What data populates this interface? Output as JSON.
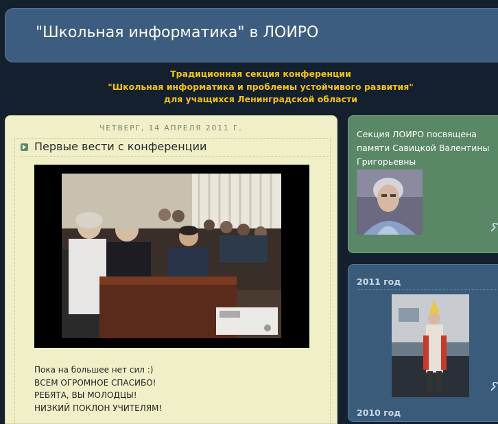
{
  "header": {
    "title": "\"Школьная информатика\" в ЛОИРО",
    "description_lines": [
      "Традиционная секция конференции",
      "\"Школьная информатика и проблемы устойчивого развития\"",
      "для учащихся Ленинградской области"
    ]
  },
  "post": {
    "date": "ЧЕТВЕРГ, 14 АПРЕЛЯ 2011 Г.",
    "title": "Первые вести с конференции",
    "body_lines": [
      "Пока на большее нет сил :)",
      "ВСЕМ ОГРОМНОЕ СПАСИБО!",
      "РЕБЯТА, ВЫ МОЛОДЦЫ!",
      "НИЗКИЙ ПОКЛОН УЧИТЕЛЯМ!"
    ]
  },
  "sidebar": {
    "widget1_title": "Секция ЛОИРО посвящена памяти Савицкой Валентины Григорьевны",
    "widget2_title": "2011 год",
    "widget3_title_partial": "2010 год"
  },
  "icons": {
    "post_arrow": "arrow-right-icon",
    "edit": "wrench-icon"
  },
  "colors": {
    "page_bg": "#14202e",
    "header_bg": "#3c5d7f",
    "description": "#f2c21a",
    "post_bg": "#f0efc8",
    "widget_green": "#5a8766",
    "widget_blue": "#3b5b7b"
  }
}
